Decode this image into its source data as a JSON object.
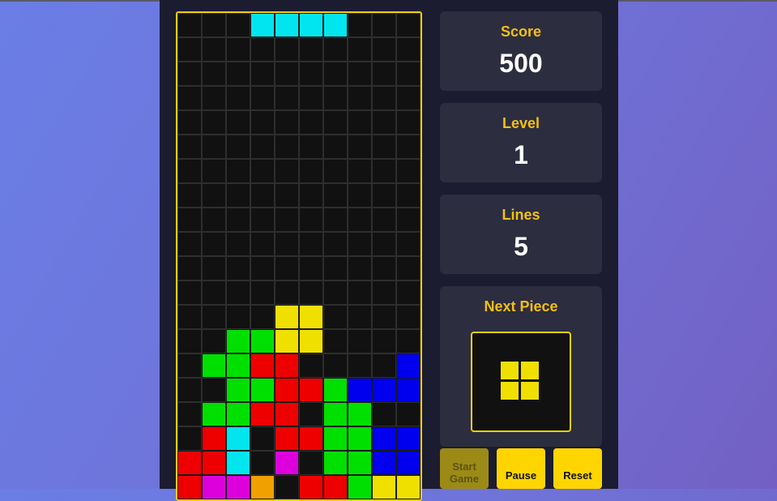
{
  "board": {
    "cols": 10,
    "visible_rows": 20,
    "empty_color": "#111111",
    "grid_color": "#2e2e2e",
    "rows": [
      "...IIII...",
      "..........",
      "..........",
      "..........",
      "..........",
      "..........",
      "..........",
      "..........",
      "..........",
      "..........",
      "..........",
      "..........",
      "....OO....",
      "..GGOO....",
      ".GGZZ....J",
      "..GGZZGJJJ",
      ".GGZZ.GG..",
      ".ZI.ZZGGJJ",
      "ZZI.T.GGJJ",
      "ZTTL.ZZGOO"
    ],
    "colors": {
      "I": "#00e5ee",
      "O": "#f0e000",
      "G": "#00e000",
      "Z": "#ee0000",
      "J": "#0000ee",
      "T": "#dd00dd",
      "L": "#f0a000"
    }
  },
  "stats": {
    "score_label": "Score",
    "score_value": "500",
    "level_label": "Level",
    "level_value": "1",
    "lines_label": "Lines",
    "lines_value": "5"
  },
  "next_piece": {
    "label": "Next Piece",
    "piece": "O",
    "color": "#f0e000"
  },
  "controls": {
    "start_label": "Start Game",
    "pause_label": "Pause",
    "reset_label": "Reset",
    "start_disabled": true
  },
  "accent_color": "#ffd500"
}
